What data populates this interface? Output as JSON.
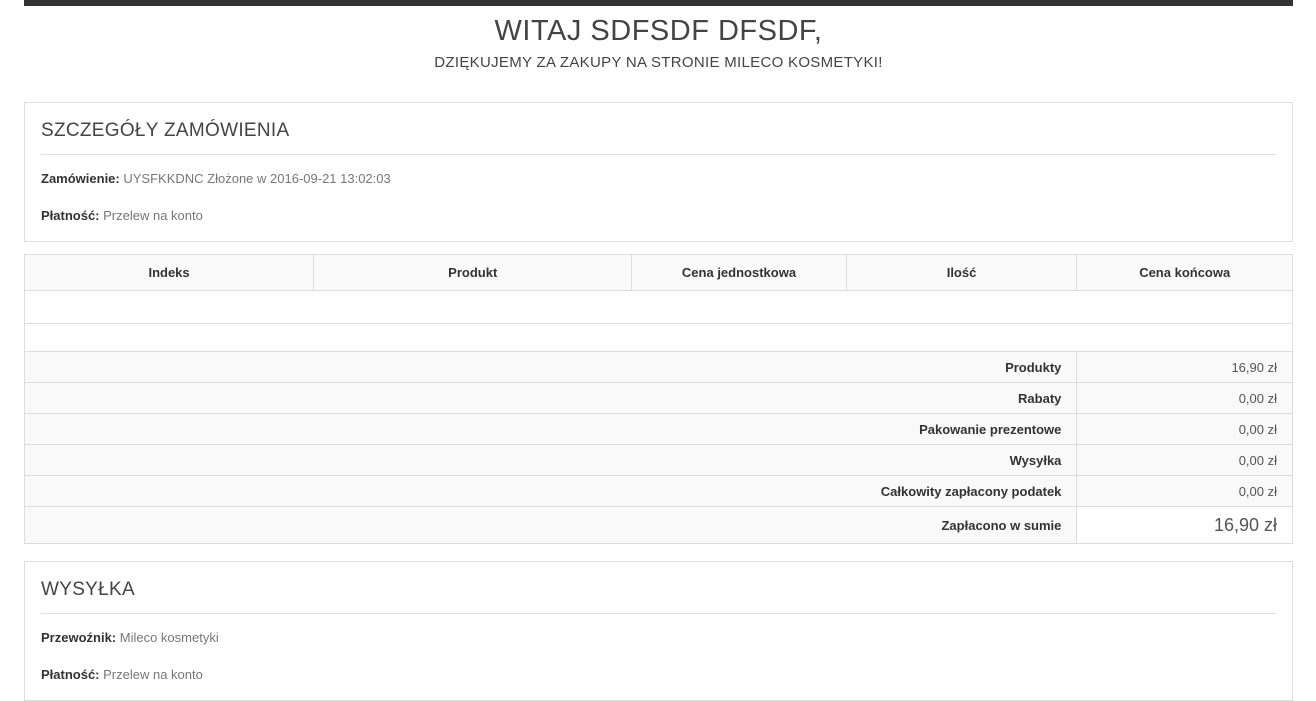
{
  "header": {
    "title": "WITAJ SDFSDF DFSDF,",
    "subtitle": "DZIĘKUJEMY ZA ZAKUPY NA STRONIE MILECO KOSMETYKI!"
  },
  "order_details": {
    "heading": "SZCZEGÓŁY ZAMÓWIENIA",
    "order_label": "Zamówienie:",
    "order_value": "UYSFKKDNC Złożone w 2016-09-21 13:02:03",
    "payment_label": "Płatność:",
    "payment_value": "Przelew na konto"
  },
  "order_table": {
    "columns": [
      "Indeks",
      "Produkt",
      "Cena jednostkowa",
      "Ilość",
      "Cena końcowa"
    ],
    "summary": [
      {
        "label": "Produkty",
        "value": "16,90 zł"
      },
      {
        "label": "Rabaty",
        "value": "0,00 zł"
      },
      {
        "label": "Pakowanie prezentowe",
        "value": "0,00 zł"
      },
      {
        "label": "Wysyłka",
        "value": "0,00 zł"
      },
      {
        "label": "Całkowity zapłacony podatek",
        "value": "0,00 zł"
      }
    ],
    "total": {
      "label": "Zapłacono w sumie",
      "value": "16,90 zł"
    }
  },
  "shipping": {
    "heading": "WYSYŁKA",
    "carrier_label": "Przewoźnik:",
    "carrier_value": "Mileco kosmetyki",
    "payment_label": "Płatność:",
    "payment_value": "Przelew na konto"
  },
  "colors": {
    "top_bar": "#333333",
    "heading_text": "#444444",
    "label_text": "#333333",
    "muted_text": "#777777",
    "border": "#dddddd",
    "table_header_bg": "#fafafa",
    "summary_row_bg": "#f9f9f9"
  }
}
